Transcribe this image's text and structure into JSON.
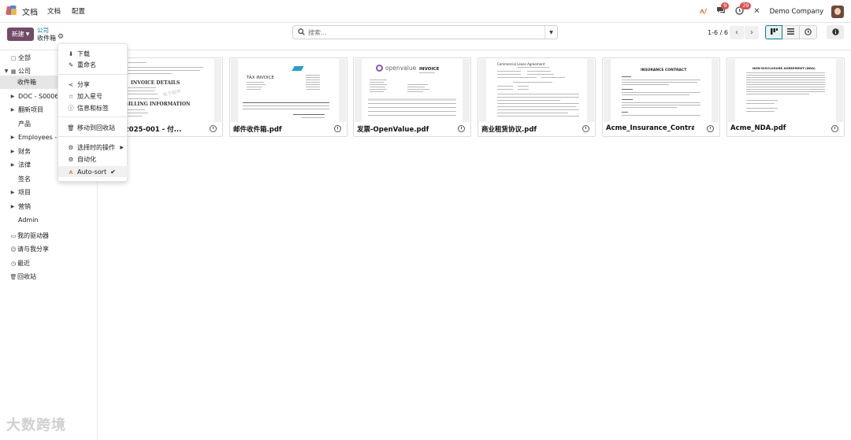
{
  "app": {
    "title": "文档",
    "menu": [
      "文档",
      "配置"
    ]
  },
  "systray": {
    "chat_badge": "9",
    "activity_badge": "29",
    "company": "Demo Company"
  },
  "control": {
    "new_label": "新建",
    "breadcrumb_parent": "公司",
    "breadcrumb_current": "收件箱",
    "search_placeholder": "搜索...",
    "pager": "1-6 / 6"
  },
  "sidebar": {
    "items": [
      {
        "label": "全部",
        "icon": "folder-icon",
        "level": 0
      },
      {
        "label": "公司",
        "icon": "building-icon",
        "level": 0,
        "expanded": true
      },
      {
        "label": "收件箱",
        "level": 1,
        "selected": true
      },
      {
        "label": "DOC - S00060",
        "level": 1,
        "collapsed": true
      },
      {
        "label": "翻新项目",
        "level": 1,
        "collapsed": true
      },
      {
        "label": "产品",
        "level": 1
      },
      {
        "label": "Employees - N",
        "level": 1,
        "collapsed": true
      },
      {
        "label": "财务",
        "level": 1,
        "collapsed": true
      },
      {
        "label": "法律",
        "level": 1,
        "collapsed": true
      },
      {
        "label": "签名",
        "level": 1
      },
      {
        "label": "项目",
        "level": 1,
        "collapsed": true
      },
      {
        "label": "营销",
        "level": 1,
        "collapsed": true
      },
      {
        "label": "Admin",
        "level": 1
      },
      {
        "label": "我的驱动器",
        "icon": "hdd-icon",
        "level": 0
      },
      {
        "label": "请与我分享",
        "icon": "users-icon",
        "level": 0
      },
      {
        "label": "最近",
        "icon": "clock-icon",
        "level": 0
      },
      {
        "label": "回收站",
        "icon": "trash-icon",
        "level": 0
      }
    ]
  },
  "documents": [
    {
      "name": "INV-2025-001 - 付..."
    },
    {
      "name": "邮件收件箱.pdf"
    },
    {
      "name": "发票-OpenValue.pdf"
    },
    {
      "name": "商业租赁协议.pdf"
    },
    {
      "name": "Acme_Insurance_Contra..."
    },
    {
      "name": "Acme_NDA.pdf"
    }
  ],
  "thumbs": {
    "inv_heading": "INVOICE DETAILS",
    "inv_billing": "BILLING INFORMATION",
    "inv_watermark": "电子邮件",
    "tax_invoice": "TAX INVOICE",
    "openvalue_brand": "openvalue",
    "openvalue_invoice": "INVOICE",
    "lease_title": "Commercial Lease Agreement",
    "insurance_title": "INSURANCE CONTRACT",
    "nda_title": "NON-DISCLOSURE AGREEMENT (NDA)"
  },
  "dropdown": {
    "items": [
      {
        "label": "下载",
        "icon": "download-icon"
      },
      {
        "label": "重命名",
        "icon": "edit-icon"
      },
      {
        "label": "分享",
        "icon": "share-icon"
      },
      {
        "label": "加入星号",
        "icon": "star-icon"
      },
      {
        "label": "信息和标签",
        "icon": "info-icon"
      },
      {
        "label": "移动到回收站",
        "icon": "trash-icon"
      },
      {
        "label": "选择时的操作",
        "icon": "cogs-icon",
        "has_submenu": true
      },
      {
        "label": "自动化",
        "icon": "gear-icon"
      },
      {
        "label": "Auto-sort",
        "icon": "ai-icon",
        "checked": true
      }
    ]
  },
  "watermark": "大数跨境",
  "colors": {
    "brand": "#714b67",
    "link": "#0a7c8a",
    "badge": "#d9534f"
  }
}
